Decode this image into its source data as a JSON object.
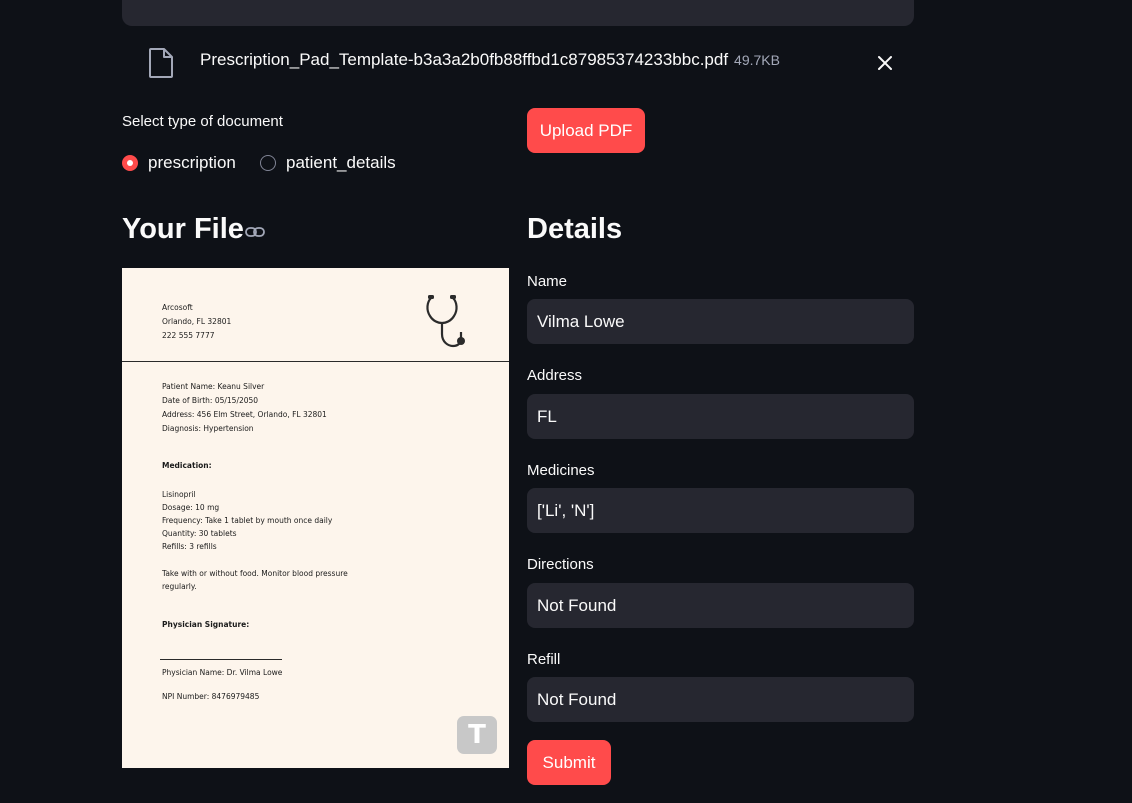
{
  "uploader": {
    "file_name": "Prescription_Pad_Template-b3a3a2b0fb88ffbd1c87985374233bbc.pdf",
    "file_size": "49.7KB"
  },
  "doc_type": {
    "label": "Select type of document",
    "options": [
      "prescription",
      "patient_details"
    ],
    "selected": "prescription"
  },
  "upload_button": "Upload PDF",
  "your_file_title": "Your File",
  "details_title": "Details",
  "pdf": {
    "clinic": [
      "Arcosoft",
      "Orlando, FL 32801",
      "222 555 7777"
    ],
    "patient": [
      "Patient Name: Keanu Silver",
      "Date of Birth: 05/15/2050",
      "Address: 456 Elm Street, Orlando, FL 32801",
      "Diagnosis: Hypertension"
    ],
    "medication_heading": "Medication:",
    "medication": [
      "Lisinopril",
      "Dosage: 10 mg",
      "Frequency: Take 1 tablet by mouth once daily",
      "Quantity: 30 tablets",
      "Refills: 3 refills"
    ],
    "notes": [
      "Take with or without food. Monitor blood pressure",
      "regularly."
    ],
    "signature_heading": "Physician Signature:",
    "physician_name": "Physician Name: Dr. Vilma Lowe",
    "npi": "NPI Number: 8476979485",
    "watermark_letter": "T"
  },
  "fields": [
    {
      "label": "Name",
      "value": "Vilma Lowe"
    },
    {
      "label": "Address",
      "value": "FL"
    },
    {
      "label": "Medicines",
      "value": "['Li', 'N']"
    },
    {
      "label": "Directions",
      "value": "Not Found"
    },
    {
      "label": "Refill",
      "value": "Not Found"
    }
  ],
  "submit_button": "Submit",
  "colors": {
    "accent": "#ff4b4b",
    "background": "#0e1117",
    "input_bg": "#262730"
  }
}
